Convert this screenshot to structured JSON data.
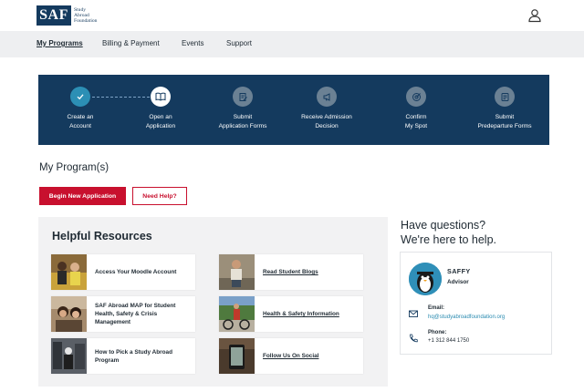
{
  "brand": {
    "logo": "SAF",
    "name_lines": [
      "Study",
      "Abroad",
      "Foundation"
    ]
  },
  "header": {
    "user_icon": "user-icon"
  },
  "nav": {
    "items": [
      {
        "label": "My Programs",
        "active": true
      },
      {
        "label": "Billing & Payment"
      },
      {
        "label": "Events"
      },
      {
        "label": "Support"
      }
    ]
  },
  "progress": {
    "steps": [
      {
        "line1": "Create an",
        "line2": "Account",
        "icon": "check-icon",
        "state": "completed"
      },
      {
        "line1": "Open an",
        "line2": "Application",
        "icon": "book-icon",
        "state": "current"
      },
      {
        "line1": "Submit",
        "line2": "Application Forms",
        "icon": "form-icon",
        "state": "upcoming"
      },
      {
        "line1": "Receive Admission",
        "line2": "Decision",
        "icon": "megaphone-icon",
        "state": "upcoming"
      },
      {
        "line1": "Confirm",
        "line2": "My Spot",
        "icon": "target-icon",
        "state": "upcoming"
      },
      {
        "line1": "Submit",
        "line2": "Predeparture Forms",
        "icon": "document-icon",
        "state": "upcoming"
      }
    ]
  },
  "programs": {
    "title": "My Program(s)",
    "new_button": "Begin New Application",
    "help_button": "Need Help?"
  },
  "resources": {
    "title": "Helpful Resources",
    "items": [
      {
        "label": "Access Your Moodle Account"
      },
      {
        "label": "Read Student Blogs"
      },
      {
        "label": "SAF Abroad MAP for Student Health, Safety & Crisis Management"
      },
      {
        "label": "Health & Safety Information"
      },
      {
        "label": "How to Pick a Study Abroad Program"
      },
      {
        "label": "Follow Us On Social"
      }
    ]
  },
  "questions": {
    "title_line1": "Have questions?",
    "title_line2": "We're here to help.",
    "advisor_name": "SAFFY",
    "advisor_role": "Advisor",
    "email_label": "Email:",
    "email": "hq@studyabroadfoundation.org",
    "phone_label": "Phone:",
    "phone": "+1 312 844 1750"
  },
  "colors": {
    "navy": "#143a5e",
    "accent_red": "#c8102e",
    "teal": "#2a8bb0",
    "step_active": "#2c8fb5"
  }
}
